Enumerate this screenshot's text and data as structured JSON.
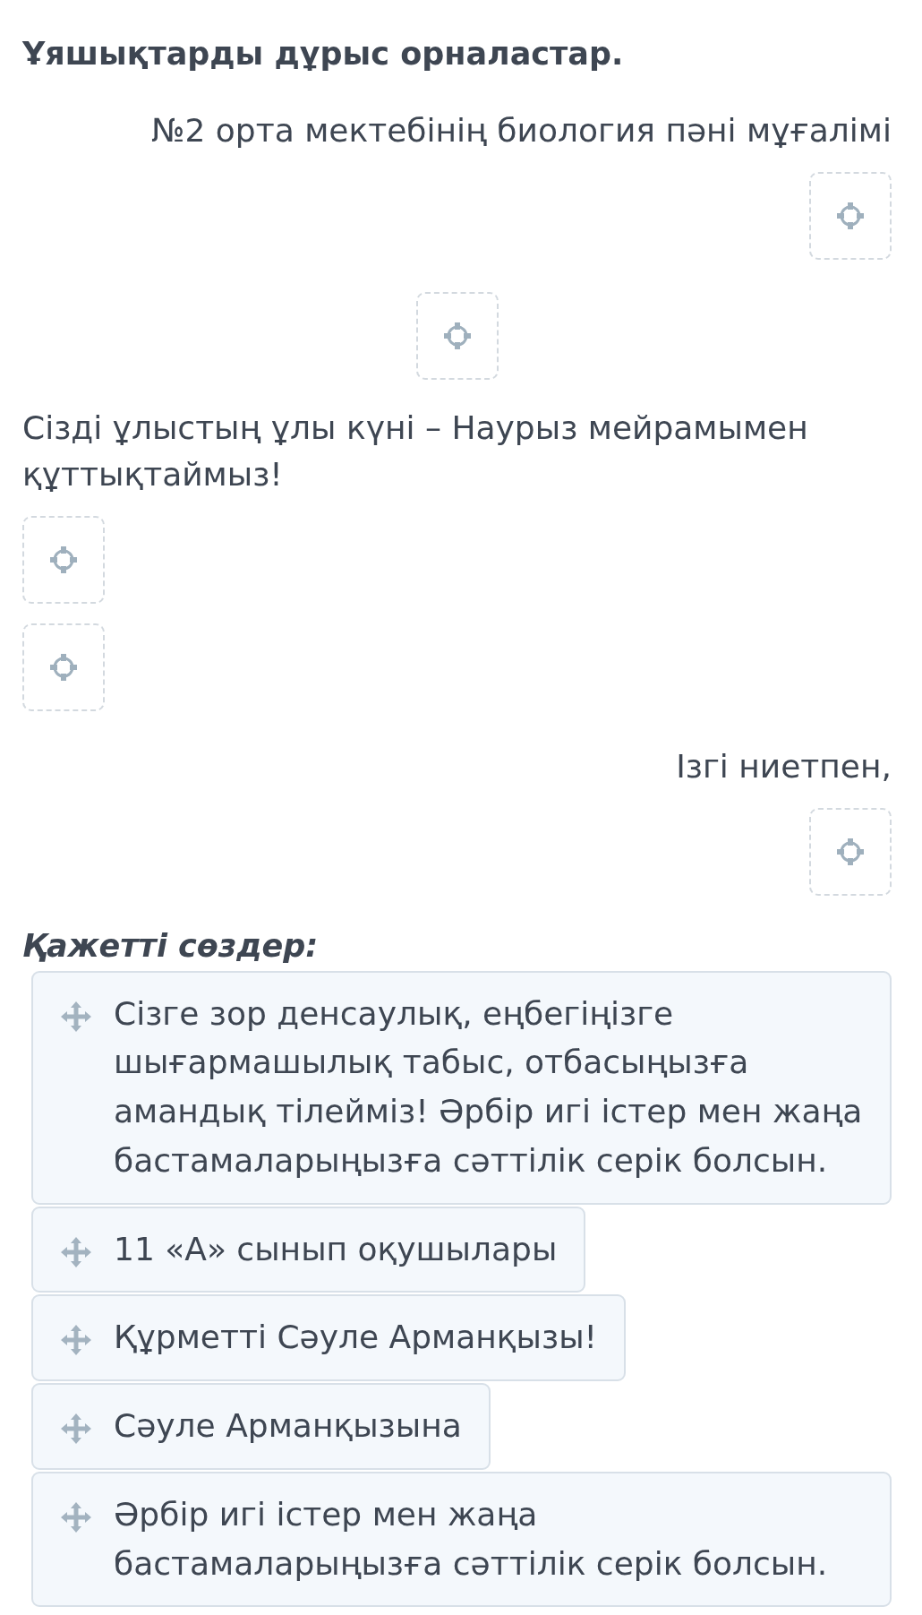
{
  "instruction": "Ұяшықтарды дұрыс орналастар.",
  "template": [
    {
      "kind": "right-text",
      "text": "№2 орта мектебінің биология пәні мұғалімі"
    },
    {
      "kind": "right-blank"
    },
    {
      "kind": "center-blank"
    },
    {
      "kind": "left-text",
      "text": "Сізді ұлыстың ұлы күні – Наурыз мейрамымен құттықтаймыз!"
    },
    {
      "kind": "left-blank"
    },
    {
      "kind": "left-blank"
    },
    {
      "kind": "right-text",
      "text": "Ізгі ниетпен,"
    },
    {
      "kind": "right-blank"
    }
  ],
  "word_bank": {
    "title": "Қажетті сөздер:",
    "items": [
      {
        "text": "Сізге зор денсаулық, еңбегіңізге шығармашылық табыс, отбасыңызға амандық тілейміз! Әрбір игі істер мен жаңа бастамаларыңызға сәттілік серік болсын."
      },
      {
        "text": "11 «А» сынып оқушылары"
      },
      {
        "text": "Құрметті Сәуле Арманқызы!"
      },
      {
        "text": "Сәуле Арманқызына"
      },
      {
        "text": "Әрбір игі істер мен жаңа бастамаларыңызға сәттілік серік болсын."
      }
    ]
  }
}
